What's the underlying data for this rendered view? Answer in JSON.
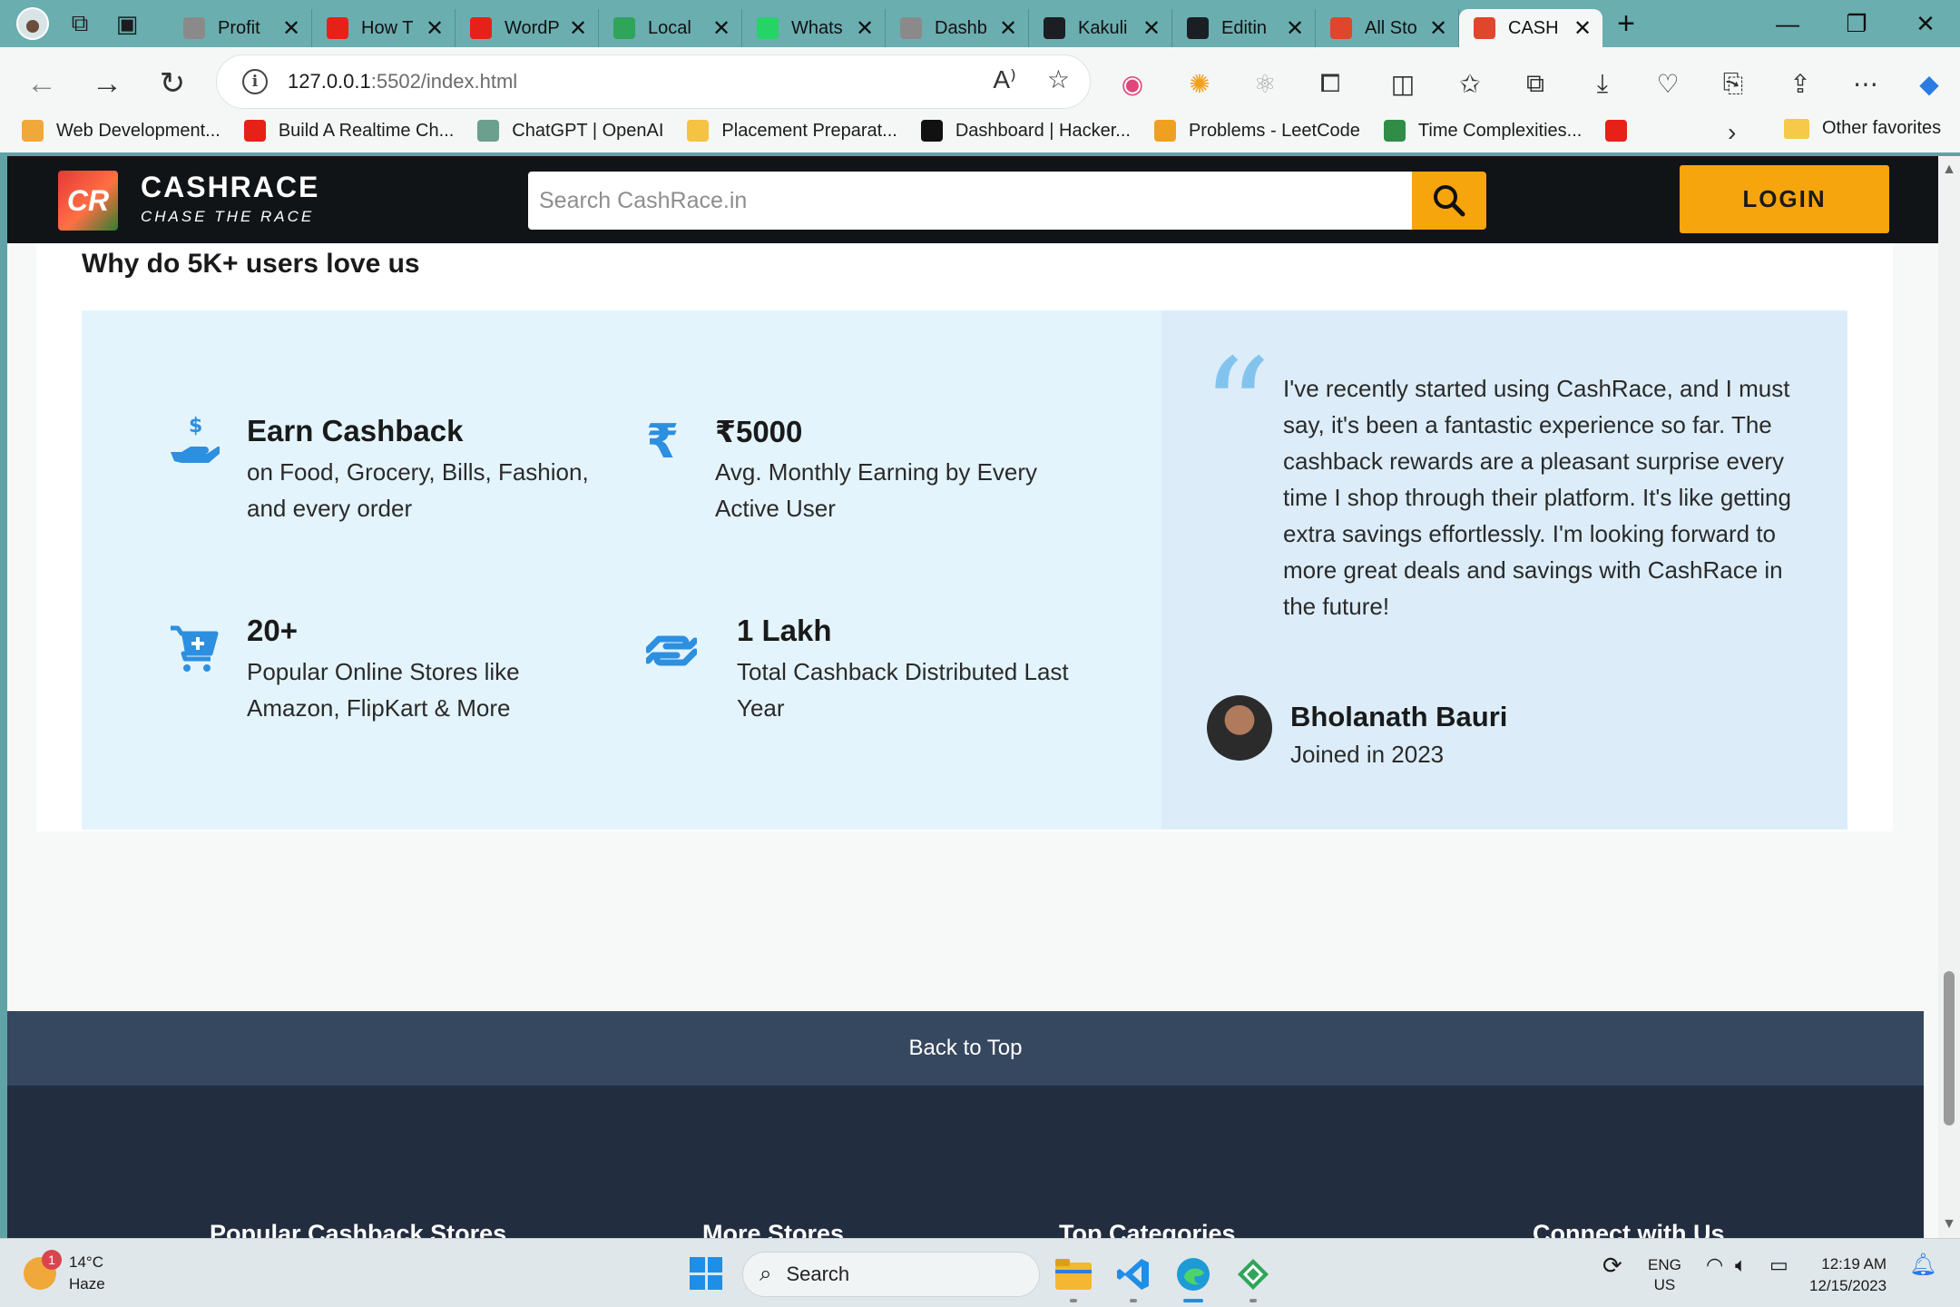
{
  "browser": {
    "tabs": [
      {
        "title": "Profit",
        "favicon": "cashrace-icon",
        "color": "#8a8a8a"
      },
      {
        "title": "How T",
        "favicon": "youtube-icon",
        "color": "#e62117"
      },
      {
        "title": "WordP",
        "favicon": "youtube-icon",
        "color": "#e62117"
      },
      {
        "title": "Local",
        "favicon": "diamond-icon",
        "color": "#2fa55a"
      },
      {
        "title": "Whats",
        "favicon": "whatsapp-icon",
        "color": "#25d366"
      },
      {
        "title": "Dashb",
        "favicon": "cashrace-icon",
        "color": "#8a8a8a"
      },
      {
        "title": "Kakuli",
        "favicon": "github-icon",
        "color": "#1b1f23"
      },
      {
        "title": "Editin",
        "favicon": "github-icon",
        "color": "#1b1f23"
      },
      {
        "title": "All Sto",
        "favicon": "cashrace-icon",
        "color": "#e0462b"
      },
      {
        "title": "CASH",
        "favicon": "cashrace-icon",
        "color": "#e0462b"
      }
    ],
    "address": {
      "host": "127.0.0.1",
      "rest": ":5502/index.html"
    },
    "bookmarks": [
      {
        "label": "Web Development...",
        "favicon": "bulb-icon",
        "color": "#f0a83a"
      },
      {
        "label": "Build A Realtime Ch...",
        "favicon": "youtube-icon",
        "color": "#e62117"
      },
      {
        "label": "ChatGPT | OpenAI",
        "favicon": "openai-icon",
        "color": "#6b9f8e"
      },
      {
        "label": "Placement Preparat...",
        "favicon": "placement-icon",
        "color": "#f5c342"
      },
      {
        "label": "Dashboard | Hacker...",
        "favicon": "hackerrank-icon",
        "color": "#111111"
      },
      {
        "label": "Problems - LeetCode",
        "favicon": "leetcode-icon",
        "color": "#f0a020"
      },
      {
        "label": "Time Complexities...",
        "favicon": "gfg-icon",
        "color": "#2f8d46"
      },
      {
        "label": "",
        "favicon": "youtube-icon",
        "color": "#e62117"
      }
    ],
    "other_favorites": "Other favorites"
  },
  "site": {
    "logo_text": "CR",
    "brand": "CASHRACE",
    "tagline": "CHASE THE RACE",
    "search_placeholder": "Search CashRace.in",
    "login": "LOGIN",
    "accent": "#f7a50c"
  },
  "section": {
    "title": "Why do 5K+ users love us",
    "features": [
      {
        "icon": "hand-dollar-icon",
        "title": "Earn Cashback",
        "desc": "on Food, Grocery, Bills, Fashion, and every order"
      },
      {
        "icon": "rupee-icon",
        "title": "₹5000",
        "desc": "Avg. Monthly Earning by Every Active User"
      },
      {
        "icon": "cart-plus-icon",
        "title": "20+",
        "desc": "Popular Online Stores like Amazon, FlipKart & More"
      },
      {
        "icon": "hand-holding-icon",
        "title": "1 Lakh",
        "desc": "Total Cashback Distributed Last Year"
      }
    ],
    "testimonial": {
      "text": "I've recently started using CashRace, and I must say, it's been a fantastic experience so far. The cashback rewards are a pleasant surprise every time I shop through their platform. It's like getting extra savings effortlessly. I'm looking forward to more great deals and savings with CashRace in the future!",
      "name": "Bholanath Bauri",
      "joined": "Joined in 2023"
    }
  },
  "footer": {
    "back_to_top": "Back to Top",
    "columns": [
      "Popular Cashback Stores",
      "More Stores",
      "Top Categories",
      "Connect with Us"
    ]
  },
  "taskbar": {
    "weather": {
      "temp": "14°C",
      "condition": "Haze",
      "badge": "1"
    },
    "search": "Search",
    "lang": "ENG",
    "region": "US",
    "time": "12:19 AM",
    "date": "12/15/2023"
  }
}
